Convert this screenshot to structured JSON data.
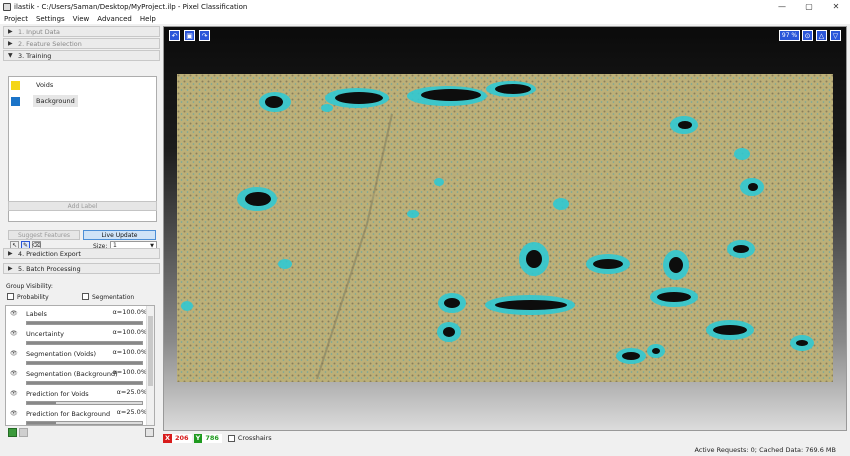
{
  "window": {
    "title": "ilastik - C:/Users/Saman/Desktop/MyProject.ilp - Pixel Classification",
    "controls": [
      "—",
      "▢",
      "✕"
    ]
  },
  "menu": [
    "Project",
    "Settings",
    "View",
    "Advanced",
    "Help"
  ],
  "applets": [
    {
      "label": "1. Input Data",
      "active": false
    },
    {
      "label": "2. Feature Selection",
      "active": false
    },
    {
      "label": "3. Training",
      "active": true
    },
    {
      "label": "4. Prediction Export",
      "active": true
    },
    {
      "label": "5. Batch Processing",
      "active": true
    }
  ],
  "labels": [
    {
      "name": "Voids",
      "color": "#f4d617"
    },
    {
      "name": "Background",
      "color": "#1b74c8"
    }
  ],
  "training": {
    "add_label": "Add Label",
    "size_label": "Size:",
    "size_value": "1",
    "suggest_features": "Suggest Features",
    "live_update": "Live Update"
  },
  "group_visibility": {
    "title": "Group Visibility:",
    "probability": "Probability",
    "segmentation": "Segmentation"
  },
  "layers": [
    {
      "name": "Labels",
      "opacity": "α=100.0%",
      "visible": true
    },
    {
      "name": "Uncertainty",
      "opacity": "α=100.0%",
      "visible": true
    },
    {
      "name": "Segmentation (Voids)",
      "opacity": "α=100.0%",
      "visible": true
    },
    {
      "name": "Segmentation (Background)",
      "opacity": "α=100.0%",
      "visible": true
    },
    {
      "name": "Prediction for Voids",
      "opacity": "α=25.0%",
      "visible": true
    },
    {
      "name": "Prediction for Background",
      "opacity": "α=25.0%",
      "visible": true
    }
  ],
  "viewer": {
    "zoom": "97 %",
    "nav_icons": [
      "rotate-left-icon",
      "fit-icon",
      "rotate-right-icon"
    ]
  },
  "status": {
    "x_key": "X",
    "x_val": "206",
    "y_key": "Y",
    "y_val": "786",
    "crosshairs": "Crosshairs",
    "cache": "Active Requests: 0; Cached Data: 769.6 MB"
  }
}
